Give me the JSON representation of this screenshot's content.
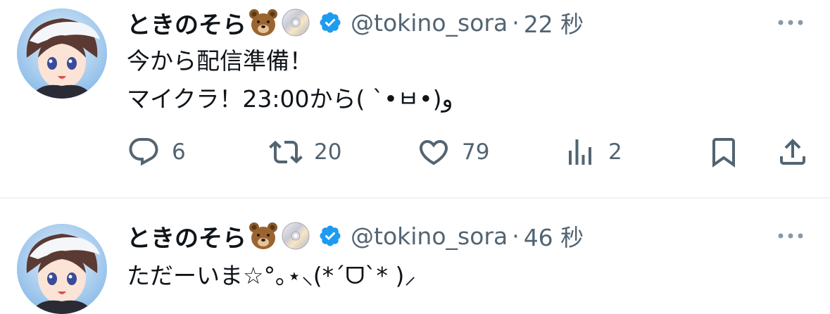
{
  "tweets": [
    {
      "display_name": "ときのそら",
      "name_emojis": [
        "bear-emoji",
        "cd-emoji"
      ],
      "verified": true,
      "handle": "@tokino_sora",
      "separator": "·",
      "time": "22 秒",
      "text_lines": [
        "今から配信準備！",
        "マイクラ！23:00から( ˋ•ㅂ•)و"
      ],
      "reply_count": "6",
      "retweet_count": "20",
      "like_count": "79",
      "view_count": "2"
    },
    {
      "display_name": "ときのそら",
      "name_emojis": [
        "bear-emoji",
        "cd-emoji"
      ],
      "verified": true,
      "handle": "@tokino_sora",
      "separator": "·",
      "time": "46 秒",
      "text_lines": [
        "ただーいま☆°｡⋆⸜(*ˊᗜˋ* )⸝"
      ]
    }
  ],
  "colors": {
    "text_primary": "#0f1419",
    "text_secondary": "#536471",
    "verified_blue": "#1d9bf0",
    "divider": "#eff3f4"
  },
  "icons": {
    "reply": "reply-icon",
    "retweet": "retweet-icon",
    "like": "heart-icon",
    "views": "views-chart-icon",
    "bookmark": "bookmark-icon",
    "share": "share-icon",
    "more": "more-dots-icon",
    "verified": "verified-badge-icon"
  }
}
